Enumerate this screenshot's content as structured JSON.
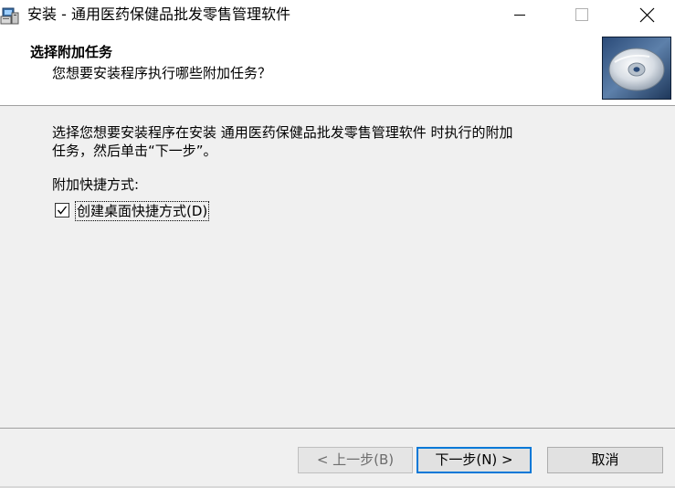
{
  "window": {
    "title": "安装 - 通用医药保健品批发零售管理软件",
    "controls": {
      "minimize_icon": "minimize-icon",
      "maximize_icon": "maximize-icon",
      "close_icon": "close-icon"
    }
  },
  "header": {
    "title": "选择附加任务",
    "subtitle": "您想要安装程序执行哪些附加任务？"
  },
  "main": {
    "description_line1": "选择您想要安装程序在安装 通用医药保健品批发零售管理软件 时执行的附加",
    "description_line2": "任务，然后单击“下一步”。",
    "group_label": "附加快捷方式:",
    "checkbox": {
      "label": "创建桌面快捷方式(D)",
      "checked": true
    }
  },
  "buttons": {
    "back": "< 上一步(B)",
    "next": "下一步(N) >",
    "cancel": "取消"
  }
}
